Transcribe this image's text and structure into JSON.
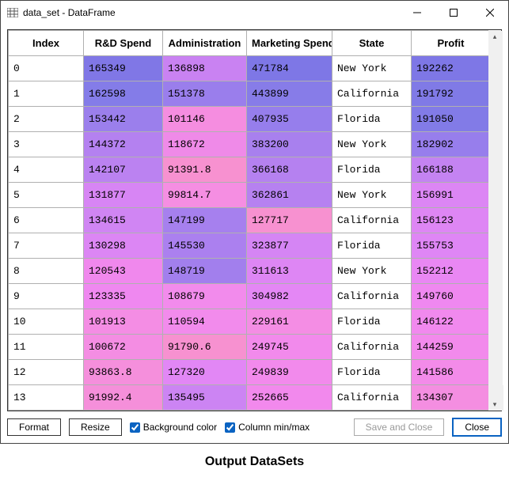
{
  "window": {
    "title": "data_set - DataFrame"
  },
  "columns": [
    "Index",
    "R&D Spend",
    "Administration",
    "Marketing Spend",
    "State",
    "Profit"
  ],
  "rows": [
    {
      "index": "0",
      "rd": "165349",
      "admin": "136898",
      "mkt": "471784",
      "state": "New York",
      "profit": "192262",
      "c": {
        "rd": "#8077e6",
        "admin": "#c982f2",
        "mkt": "#7e77e6",
        "profit": "#7e77e6"
      }
    },
    {
      "index": "1",
      "rd": "162598",
      "admin": "151378",
      "mkt": "443899",
      "state": "California",
      "profit": "191792",
      "c": {
        "rd": "#847ce8",
        "admin": "#9a7eec",
        "mkt": "#877ce8",
        "profit": "#807ae6"
      }
    },
    {
      "index": "2",
      "rd": "153442",
      "admin": "101146",
      "mkt": "407935",
      "state": "Florida",
      "profit": "191050",
      "c": {
        "rd": "#9b7fec",
        "admin": "#f58de0",
        "mkt": "#967eec",
        "profit": "#827be7"
      }
    },
    {
      "index": "3",
      "rd": "144372",
      "admin": "118672",
      "mkt": "383200",
      "state": "New York",
      "profit": "182902",
      "c": {
        "rd": "#b481f0",
        "admin": "#ef8ae8",
        "mkt": "#a880ee",
        "profit": "#977eec"
      }
    },
    {
      "index": "4",
      "rd": "142107",
      "admin": "91391.8",
      "mkt": "366168",
      "state": "Florida",
      "profit": "166188",
      "c": {
        "rd": "#bb82f1",
        "admin": "#f791d0",
        "mkt": "#b581f0",
        "profit": "#c483f2"
      }
    },
    {
      "index": "5",
      "rd": "131877",
      "admin": "99814.7",
      "mkt": "362861",
      "state": "New York",
      "profit": "156991",
      "c": {
        "rd": "#d785f4",
        "admin": "#f58ee2",
        "mkt": "#b681f0",
        "profit": "#dc86f4"
      }
    },
    {
      "index": "6",
      "rd": "134615",
      "admin": "147199",
      "mkt": "127717",
      "state": "California",
      "profit": "156123",
      "c": {
        "rd": "#d085f3",
        "admin": "#a680ee",
        "mkt": "#f791d0",
        "profit": "#de86f4"
      }
    },
    {
      "index": "7",
      "rd": "130298",
      "admin": "145530",
      "mkt": "323877",
      "state": "Florida",
      "profit": "155753",
      "c": {
        "rd": "#dc86f4",
        "admin": "#ab80ef",
        "mkt": "#d585f4",
        "profit": "#df86f5"
      }
    },
    {
      "index": "8",
      "rd": "120543",
      "admin": "148719",
      "mkt": "311613",
      "state": "New York",
      "profit": "152212",
      "c": {
        "rd": "#f088ed",
        "admin": "#a27fed",
        "mkt": "#de86f4",
        "profit": "#e987f3"
      }
    },
    {
      "index": "9",
      "rd": "123335",
      "admin": "108679",
      "mkt": "304982",
      "state": "California",
      "profit": "149760",
      "c": {
        "rd": "#ef88f0",
        "admin": "#f28bec",
        "mkt": "#e487f5",
        "profit": "#ef88f0"
      }
    },
    {
      "index": "10",
      "rd": "101913",
      "admin": "110594",
      "mkt": "229161",
      "state": "Florida",
      "profit": "146122",
      "c": {
        "rd": "#f48de4",
        "admin": "#f28bec",
        "mkt": "#f48de4",
        "profit": "#f189ee"
      }
    },
    {
      "index": "11",
      "rd": "100672",
      "admin": "91790.6",
      "mkt": "249745",
      "state": "California",
      "profit": "144259",
      "c": {
        "rd": "#f48de3",
        "admin": "#f791d0",
        "mkt": "#f28aec",
        "profit": "#f28aec"
      }
    },
    {
      "index": "12",
      "rd": "93863.8",
      "admin": "127320",
      "mkt": "249839",
      "state": "Florida",
      "profit": "141586",
      "c": {
        "rd": "#f58fdc",
        "admin": "#e287f5",
        "mkt": "#f28aec",
        "profit": "#f38be9"
      }
    },
    {
      "index": "13",
      "rd": "91992.4",
      "admin": "135495",
      "mkt": "252665",
      "state": "California",
      "profit": "134307",
      "c": {
        "rd": "#f58fda",
        "admin": "#cc84f3",
        "mkt": "#f289ed",
        "profit": "#f48ee1"
      }
    }
  ],
  "footer": {
    "format": "Format",
    "resize": "Resize",
    "bgcolor": "Background color",
    "minmax": "Column min/max",
    "save": "Save and Close",
    "close": "Close"
  },
  "caption": "Output DataSets"
}
